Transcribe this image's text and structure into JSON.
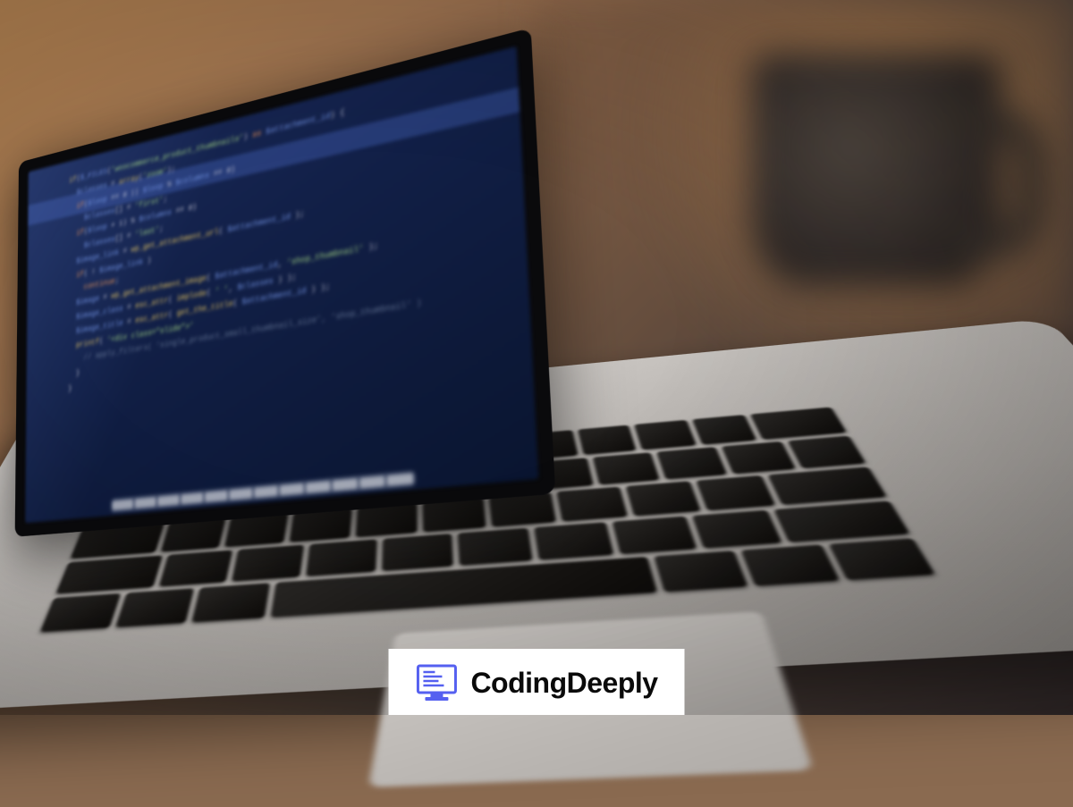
{
  "badge": {
    "text": "CodingDeeply",
    "icon_color": "#5560f0"
  },
  "screen_code": {
    "lines": [
      {
        "indent": 1,
        "tokens": [
          [
            "fn",
            "if"
          ],
          [
            "",
            "("
          ],
          [
            "var",
            "$_FILES"
          ],
          [
            "",
            "("
          ],
          [
            "str",
            "'woocommerce_product_thumbnails'"
          ],
          [
            "",
            ") "
          ],
          [
            "kw",
            "as"
          ],
          [
            "",
            " "
          ],
          [
            "var",
            "$attachment_id"
          ],
          [
            "",
            ") {"
          ]
        ]
      },
      {
        "indent": 2,
        "tokens": [
          [
            "var",
            "$classes"
          ],
          [
            "",
            " = "
          ],
          [
            "fn",
            "array"
          ],
          [
            "",
            "("
          ],
          [
            "str",
            "'zoom'"
          ],
          [
            "",
            ");"
          ]
        ]
      },
      {
        "indent": 2,
        "tokens": [
          [
            "kw",
            "if"
          ],
          [
            "",
            "("
          ],
          [
            "var",
            "$loop"
          ],
          [
            "",
            " == 0 || "
          ],
          [
            "var",
            "$loop"
          ],
          [
            "",
            " % "
          ],
          [
            "var",
            "$columns"
          ],
          [
            "",
            " == 0)"
          ]
        ]
      },
      {
        "indent": 3,
        "tokens": [
          [
            "var",
            "$classes"
          ],
          [
            "",
            "[] = "
          ],
          [
            "str",
            "'first'"
          ],
          [
            "",
            ";"
          ]
        ]
      },
      {
        "indent": 2,
        "tokens": [
          [
            "kw",
            "if"
          ],
          [
            "",
            "("
          ],
          [
            "var",
            "$loop"
          ],
          [
            "",
            " + 1) % "
          ],
          [
            "var",
            "$columns"
          ],
          [
            "",
            " == 0)"
          ]
        ]
      },
      {
        "indent": 3,
        "tokens": [
          [
            "var",
            "$classes"
          ],
          [
            "",
            "[] = "
          ],
          [
            "str",
            "'last'"
          ],
          [
            "",
            ";"
          ]
        ]
      },
      {
        "indent": 2,
        "tokens": [
          [
            "var",
            "$image_link"
          ],
          [
            "",
            " = "
          ],
          [
            "fn",
            "wp_get_attachment_url"
          ],
          [
            "",
            "( "
          ],
          [
            "var",
            "$attachment_id"
          ],
          [
            "",
            " );"
          ]
        ]
      },
      {
        "indent": 2,
        "tokens": [
          [
            "kw",
            "if"
          ],
          [
            "",
            "( ! "
          ],
          [
            "var",
            "$image_link"
          ],
          [
            "",
            " )"
          ]
        ]
      },
      {
        "indent": 3,
        "tokens": [
          [
            "kw",
            "continue"
          ],
          [
            "",
            ";"
          ]
        ]
      },
      {
        "indent": 2,
        "tokens": [
          [
            "var",
            "$image"
          ],
          [
            "",
            " = "
          ],
          [
            "fn",
            "wp_get_attachment_image"
          ],
          [
            "",
            "( "
          ],
          [
            "var",
            "$attachment_id"
          ],
          [
            "",
            ", "
          ],
          [
            "str",
            "'shop_thumbnail'"
          ],
          [
            "",
            " );"
          ]
        ]
      },
      {
        "indent": 2,
        "tokens": [
          [
            "var",
            "$image_class"
          ],
          [
            "",
            " = "
          ],
          [
            "fn",
            "esc_attr"
          ],
          [
            "",
            "( "
          ],
          [
            "fn",
            "implode"
          ],
          [
            "",
            "( "
          ],
          [
            "str",
            "' '"
          ],
          [
            "",
            ", "
          ],
          [
            "var",
            "$classes"
          ],
          [
            "",
            " ) );"
          ]
        ]
      },
      {
        "indent": 2,
        "tokens": [
          [
            "var",
            "$image_title"
          ],
          [
            "",
            " = "
          ],
          [
            "fn",
            "esc_attr"
          ],
          [
            "",
            "( "
          ],
          [
            "fn",
            "get_the_title"
          ],
          [
            "",
            "( "
          ],
          [
            "var",
            "$attachment_id"
          ],
          [
            "",
            " ) );"
          ]
        ]
      },
      {
        "indent": 2,
        "tokens": [
          [
            "fn",
            "printf"
          ],
          [
            "",
            "( "
          ],
          [
            "str",
            "'<div class=\"slide\">'"
          ]
        ]
      },
      {
        "indent": 3,
        "tokens": [
          [
            "cm",
            "// apply_filters( 'single_product_small_thumbnail_size', 'shop_thumbnail' )"
          ]
        ]
      },
      {
        "indent": 2,
        "tokens": [
          [
            "",
            "}"
          ]
        ]
      },
      {
        "indent": 1,
        "tokens": [
          [
            "",
            "}"
          ]
        ]
      }
    ]
  }
}
